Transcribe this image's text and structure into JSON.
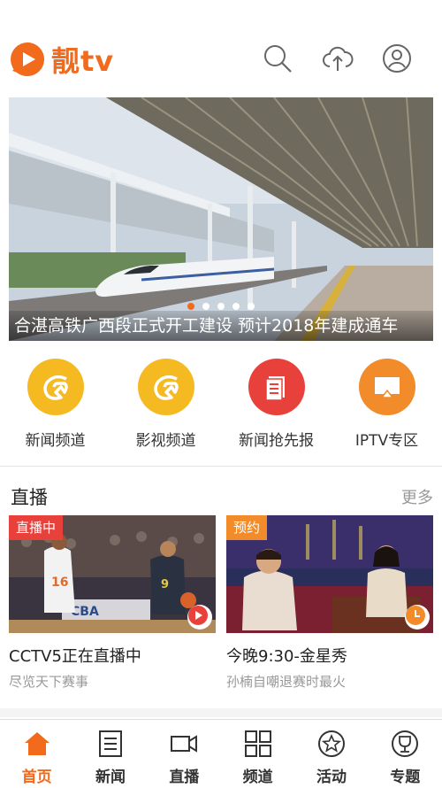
{
  "header": {
    "logo_text": "靓tv",
    "icons": [
      "search-icon",
      "upload-icon",
      "user-icon"
    ]
  },
  "banner": {
    "caption": "合湛高铁广西段正式开工建设 预计2018年建成通车",
    "slide_count": 5,
    "active_slide": 1
  },
  "shortcuts": [
    {
      "label": "新闻频道",
      "icon": "news-channel-icon",
      "color": "#f5b921"
    },
    {
      "label": "影视频道",
      "icon": "film-channel-icon",
      "color": "#f5b921"
    },
    {
      "label": "新闻抢先报",
      "icon": "breaking-news-icon",
      "color": "#e8413b"
    },
    {
      "label": "IPTV专区",
      "icon": "iptv-icon",
      "color": "#f28c2b"
    }
  ],
  "live": {
    "title": "直播",
    "more": "更多",
    "cards": [
      {
        "tag": "直播中",
        "title": "CCTV5正在直播中",
        "subtitle": "尽览天下赛事",
        "corner_icon": "play-icon"
      },
      {
        "tag": "预约",
        "title": "今晚9:30-金星秀",
        "subtitle": "孙楠自嘲退赛时最火",
        "corner_icon": "clock-icon"
      }
    ]
  },
  "bottom_nav": [
    {
      "label": "首页",
      "icon": "home-icon",
      "active": true
    },
    {
      "label": "新闻",
      "icon": "newspaper-icon",
      "active": false
    },
    {
      "label": "直播",
      "icon": "video-camera-icon",
      "active": false
    },
    {
      "label": "频道",
      "icon": "grid-icon",
      "active": false
    },
    {
      "label": "活动",
      "icon": "star-badge-icon",
      "active": false
    },
    {
      "label": "专题",
      "icon": "trophy-icon",
      "active": false
    }
  ],
  "colors": {
    "brand": "#f26a1b",
    "live_tag": "#e8413b",
    "reserve_tag": "#f28c2b",
    "gray_text": "#999999"
  }
}
